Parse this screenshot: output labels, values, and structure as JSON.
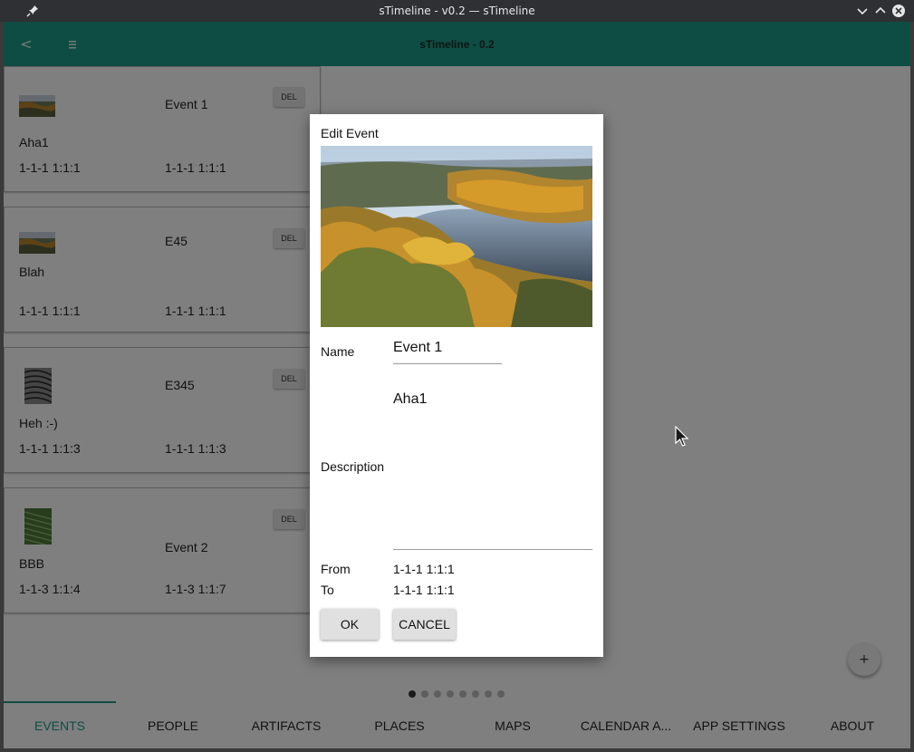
{
  "window": {
    "title": "sTimeline - v0.2 — sTimeline"
  },
  "appbar": {
    "back_label": "<",
    "title": "sTimeline - 0.2"
  },
  "events": [
    {
      "name": "Event 1",
      "description": "Aha1",
      "from": "1-1-1 1:1:1",
      "to": "1-1-1 1:1:1",
      "del_label": "DEL",
      "thumb": "landscape-thumbnail"
    },
    {
      "name": "E45",
      "description": "Blah",
      "from": "1-1-1 1:1:1",
      "to": "1-1-1 1:1:1",
      "del_label": "DEL",
      "thumb": "landscape-thumbnail"
    },
    {
      "name": "E345",
      "description": "Heh :-)",
      "from": "1-1-1 1:1:3",
      "to": "1-1-1 1:1:3",
      "del_label": "DEL",
      "thumb": "fingerprint-texture-thumbnail"
    },
    {
      "name": "Event 2",
      "description": "BBB",
      "from": "1-1-3 1:1:4",
      "to": "1-1-3 1:1:7",
      "del_label": "DEL",
      "thumb": "green-texture-thumbnail"
    }
  ],
  "pagination": {
    "total": 8,
    "active_index": 0
  },
  "fab_label": "+",
  "tabs": [
    {
      "label": "EVENTS",
      "active": true
    },
    {
      "label": "PEOPLE",
      "active": false
    },
    {
      "label": "ARTIFACTS",
      "active": false
    },
    {
      "label": "PLACES",
      "active": false
    },
    {
      "label": "MAPS",
      "active": false
    },
    {
      "label": "CALENDAR A...",
      "active": false
    },
    {
      "label": "APP SETTINGS",
      "active": false
    },
    {
      "label": "ABOUT",
      "active": false
    }
  ],
  "dialog": {
    "title": "Edit Event",
    "image": "autumn-river-landscape-photo",
    "name_label": "Name",
    "name_value": "Event 1",
    "description_label": "Description",
    "description_value": "Aha1",
    "from_label": "From",
    "from_value": "1-1-1 1:1:1",
    "to_label": "To",
    "to_value": "1-1-1 1:1:1",
    "ok_label": "OK",
    "cancel_label": "CANCEL"
  },
  "colors": {
    "accent": "#1d9a86",
    "titlebar": "#2f3034"
  }
}
